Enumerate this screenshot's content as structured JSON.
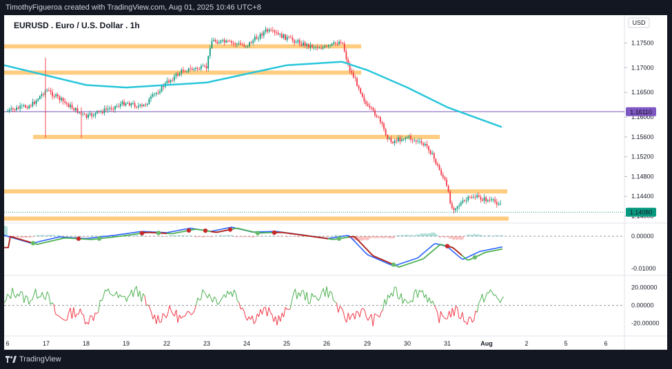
{
  "header": {
    "attribution": "TimothyFigueroa created with TradingView.com, Aug 01, 2025 10:46 UTC+8"
  },
  "footer": {
    "brand": "TradingView"
  },
  "chart_data": [
    {
      "type": "candlestick",
      "title": "EURUSD . Euro / U.S. Dollar . 1h",
      "currency": "USD",
      "x_ticks": [
        "6",
        "17",
        "18",
        "19",
        "22",
        "23",
        "24",
        "25",
        "26",
        "29",
        "30",
        "31",
        "Aug",
        "2",
        "5",
        "6"
      ],
      "y_ticks": [
        "1.17500",
        "1.17000",
        "1.16500",
        "1.16000",
        "1.15600",
        "1.15200",
        "1.14800",
        "1.14400",
        "1.14000"
      ],
      "ylim": [
        1.1393,
        1.1795
      ],
      "price_labels": [
        {
          "value": 1.1611,
          "text": "1.16110",
          "color": "#7e57c2"
        },
        {
          "value": 1.1408,
          "text": "1.14080",
          "color": "#089981"
        }
      ],
      "candle_path": [
        [
          "6",
          1.1612
        ],
        [
          "16.5",
          1.1625
        ],
        [
          "17",
          1.1655
        ],
        [
          "18",
          1.16
        ],
        [
          "19",
          1.163
        ],
        [
          "20",
          1.162
        ],
        [
          "22",
          1.167
        ],
        [
          "22.5",
          1.1695
        ],
        [
          "23",
          1.17
        ],
        [
          "23.2",
          1.1755
        ],
        [
          "24",
          1.1745
        ],
        [
          "24.5",
          1.1775
        ],
        [
          "25",
          1.176
        ],
        [
          "25.5",
          1.1745
        ],
        [
          "26",
          1.174
        ],
        [
          "26.5",
          1.1755
        ],
        [
          "27",
          1.17
        ],
        [
          "27.5",
          1.166
        ],
        [
          "28",
          1.162
        ],
        [
          "29",
          1.1605
        ],
        [
          "29.5",
          1.155
        ],
        [
          "30",
          1.156
        ],
        [
          "30.5",
          1.154
        ],
        [
          "31",
          1.147
        ],
        [
          "31.3",
          1.1415
        ],
        [
          "31.7",
          1.144
        ],
        [
          "Aug 1",
          1.1425
        ]
      ],
      "moving_average": [
        [
          1.1705,
          "6"
        ],
        [
          1.1665,
          "18"
        ],
        [
          1.166,
          "20"
        ],
        [
          1.167,
          "23"
        ],
        [
          1.1705,
          "25"
        ],
        [
          1.1712,
          "26.5"
        ],
        [
          1.1695,
          "29"
        ],
        [
          1.166,
          "30"
        ],
        [
          1.162,
          "31"
        ],
        [
          1.158,
          "Aug 1"
        ]
      ],
      "support_resistance_zones": [
        1.1743,
        1.169,
        1.156,
        1.145,
        1.1395
      ]
    },
    {
      "type": "line",
      "name": "oscillator",
      "y_ticks": [
        "0.00000",
        "-0.01000"
      ],
      "ylim": [
        -0.0125,
        0.0045
      ]
    },
    {
      "type": "line",
      "name": "momentum",
      "y_ticks": [
        "20.00000",
        "0.00000",
        "-20.00000"
      ],
      "ylim": [
        -31,
        32
      ]
    }
  ],
  "colors": {
    "up": "#089981",
    "down": "#f23645",
    "ma": "#26c6da",
    "zone": "#ffcc80",
    "hline": "#7e57c2",
    "osc_fast": "#2962ff",
    "osc_slow_up": "#4caf50",
    "osc_slow_down": "#b71c1c",
    "mom_up": "#4caf50",
    "mom_down": "#f23645"
  }
}
